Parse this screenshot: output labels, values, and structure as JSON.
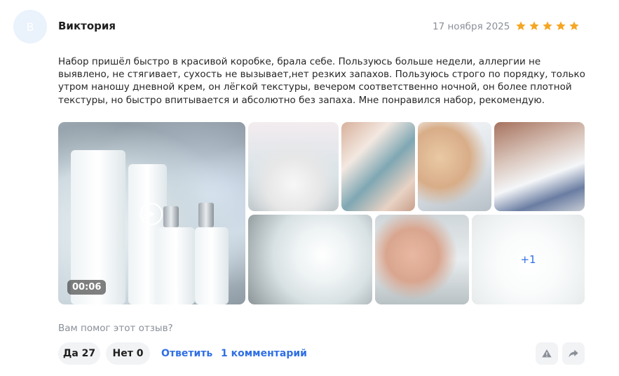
{
  "review": {
    "avatar_letter": "В",
    "author": "Виктория",
    "date": "17 ноября 2025",
    "rating": 5,
    "text": "Набор пришёл быстро в красивой коробке, брала себе. Пользуюсь больше недели, аллергии не выявлено, не стягивает, сухость не вызывает,нет резких запахов. Пользуюсь строго по порядку, только утром наношу дневной крем, он лёгкой текстуры, вечером соответственно ночной, он более плотной текстуры, но быстро впитывается и абсолютно без запаха. Мне понравился набор, рекомендую."
  },
  "media": {
    "video_duration": "00:06",
    "more_count": "+1",
    "icons": {
      "play": "play-icon"
    }
  },
  "feedback": {
    "question": "Вам помог этот отзыв?",
    "yes_label": "Да 27",
    "no_label": "Нет 0",
    "reply_label": "Ответить",
    "comments_label": "1 комментарий"
  },
  "icons": {
    "star": "star-icon",
    "report": "warning-icon",
    "share": "share-icon"
  },
  "colors": {
    "star": "#f5a623",
    "link": "#2f6fe4",
    "muted": "#8a8f98",
    "pill_bg": "#f2f3f5",
    "avatar_bg": "#eaf2fc"
  }
}
